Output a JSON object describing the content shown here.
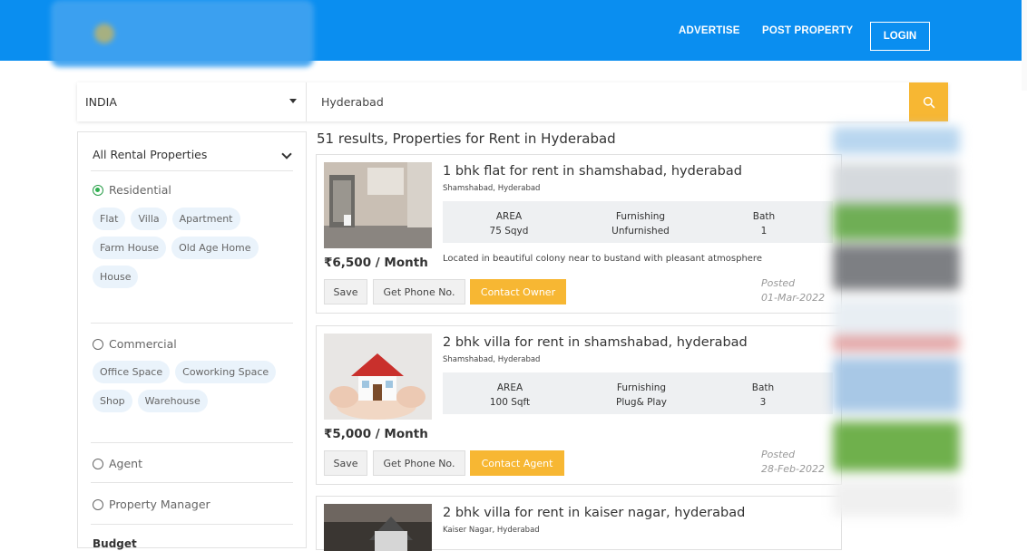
{
  "header": {
    "nav": [
      "ADVERTISE",
      "POST PROPERTY"
    ],
    "login_label": "LOGIN",
    "brand_color": "#0a8ef0"
  },
  "search": {
    "country": "INDIA",
    "query": "Hyderabad",
    "search_icon": "search-icon",
    "accent": "#f7b733"
  },
  "sidebar": {
    "heading": "All Rental Properties",
    "residential": {
      "label": "Residential",
      "selected": true,
      "chips": [
        "Flat",
        "Villa",
        "Apartment",
        "Farm House",
        "Old Age Home",
        "House"
      ]
    },
    "commercial": {
      "label": "Commercial",
      "selected": false,
      "chips": [
        "Office Space",
        "Coworking Space",
        "Shop",
        "Warehouse"
      ]
    },
    "agent_label": "Agent",
    "manager_label": "Property Manager",
    "budget_label": "Budget"
  },
  "results": {
    "title": "51 results, Properties for Rent in Hyderabad",
    "spec_labels": {
      "area": "AREA",
      "furnishing": "Furnishing",
      "bath": "Bath"
    },
    "save_label": "Save",
    "phone_label": "Get Phone No.",
    "posted_label": "Posted",
    "items": [
      {
        "title": "1 bhk flat for rent in shamshabad, hyderabad",
        "location": "Shamshabad, Hyderabad",
        "area": "75 Sqyd",
        "furnishing": "Unfurnished",
        "bath": "1",
        "description": "Located in beautiful colony near to bustand with pleasant atmosphere",
        "price": "₹6,500 / Month",
        "contact_label": "Contact Owner",
        "posted_date": "01-Mar-2022"
      },
      {
        "title": "2 bhk villa for rent in shamshabad, hyderabad",
        "location": "Shamshabad, Hyderabad",
        "area": "100 Sqft",
        "furnishing": "Plug& Play",
        "bath": "3",
        "description": "",
        "price": "₹5,000 / Month",
        "contact_label": "Contact Agent",
        "posted_date": "28-Feb-2022"
      },
      {
        "title": "2 bhk villa for rent in kaiser nagar, hyderabad",
        "location": "Kaiser Nagar, Hyderabad"
      }
    ]
  }
}
